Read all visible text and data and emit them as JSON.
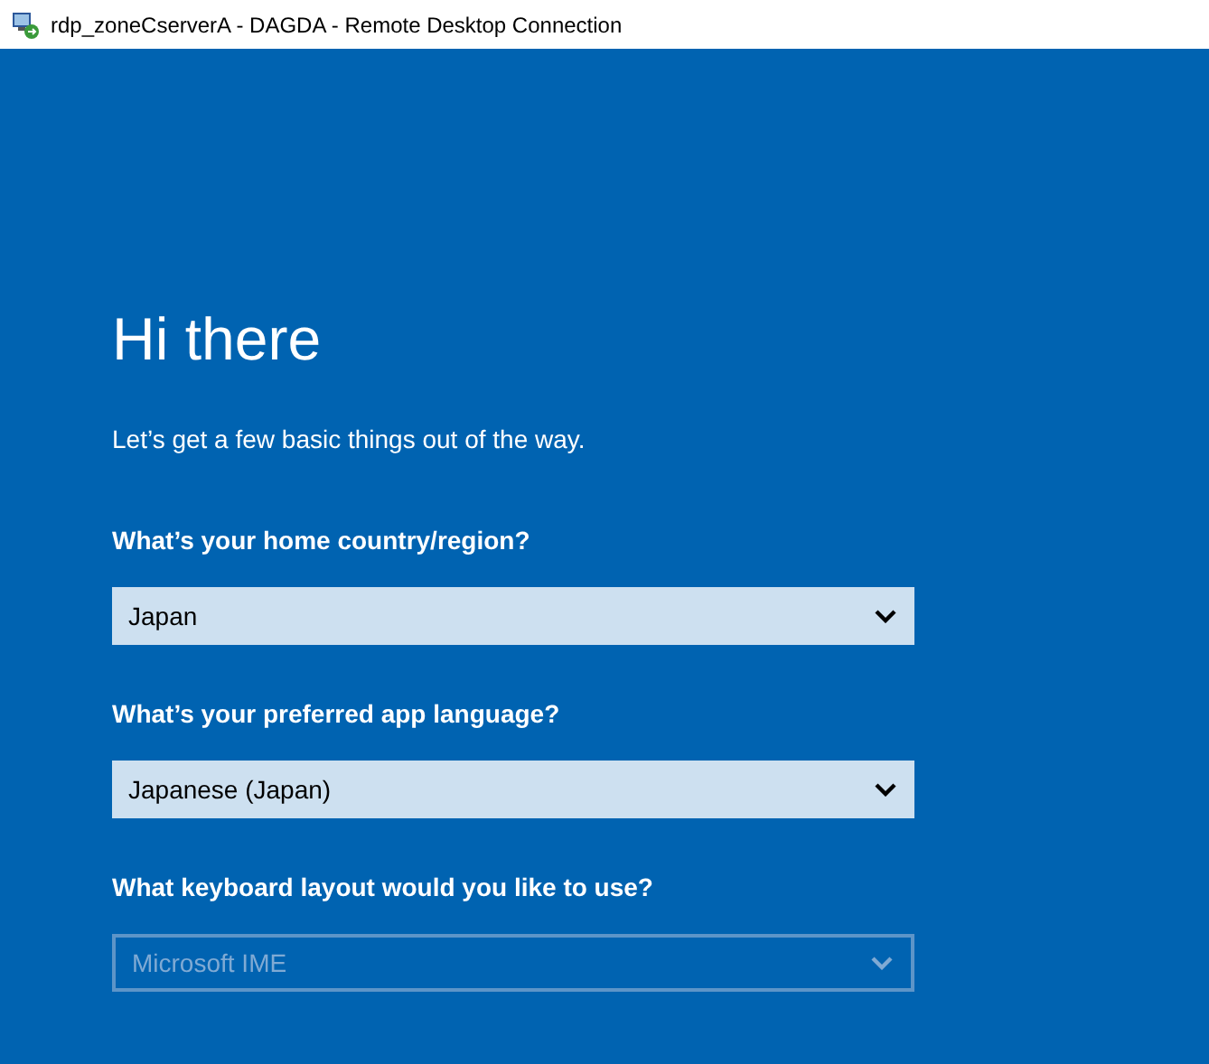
{
  "window": {
    "title": "rdp_zoneCserverA - DAGDA - Remote Desktop Connection"
  },
  "heading": "Hi there",
  "subtitle": "Let’s get a few basic things out of the way.",
  "questions": [
    {
      "label": "What’s your home country/region?",
      "value": "Japan",
      "disabled": false
    },
    {
      "label": "What’s your preferred app language?",
      "value": "Japanese (Japan)",
      "disabled": false
    },
    {
      "label": "What keyboard layout would you like to use?",
      "value": "Microsoft IME",
      "disabled": true
    }
  ]
}
